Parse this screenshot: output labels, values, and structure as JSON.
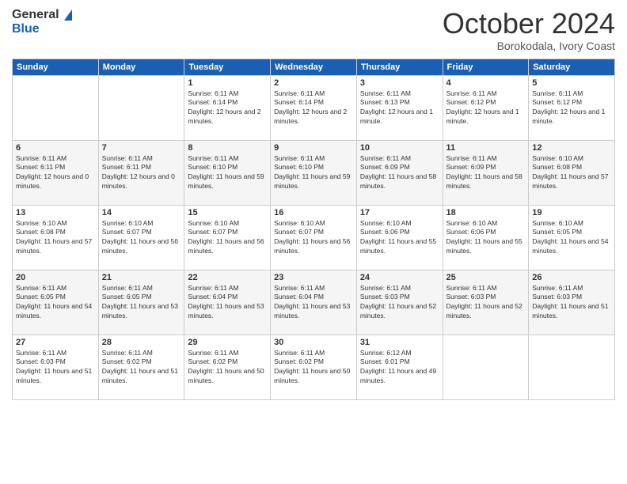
{
  "logo": {
    "general": "General",
    "blue": "Blue"
  },
  "header": {
    "month": "October 2024",
    "location": "Borokodala, Ivory Coast"
  },
  "columns": [
    "Sunday",
    "Monday",
    "Tuesday",
    "Wednesday",
    "Thursday",
    "Friday",
    "Saturday"
  ],
  "weeks": [
    [
      {
        "day": "",
        "sunrise": "",
        "sunset": "",
        "daylight": ""
      },
      {
        "day": "",
        "sunrise": "",
        "sunset": "",
        "daylight": ""
      },
      {
        "day": "1",
        "sunrise": "Sunrise: 6:11 AM",
        "sunset": "Sunset: 6:14 PM",
        "daylight": "Daylight: 12 hours and 2 minutes."
      },
      {
        "day": "2",
        "sunrise": "Sunrise: 6:11 AM",
        "sunset": "Sunset: 6:14 PM",
        "daylight": "Daylight: 12 hours and 2 minutes."
      },
      {
        "day": "3",
        "sunrise": "Sunrise: 6:11 AM",
        "sunset": "Sunset: 6:13 PM",
        "daylight": "Daylight: 12 hours and 1 minute."
      },
      {
        "day": "4",
        "sunrise": "Sunrise: 6:11 AM",
        "sunset": "Sunset: 6:12 PM",
        "daylight": "Daylight: 12 hours and 1 minute."
      },
      {
        "day": "5",
        "sunrise": "Sunrise: 6:11 AM",
        "sunset": "Sunset: 6:12 PM",
        "daylight": "Daylight: 12 hours and 1 minute."
      }
    ],
    [
      {
        "day": "6",
        "sunrise": "Sunrise: 6:11 AM",
        "sunset": "Sunset: 6:11 PM",
        "daylight": "Daylight: 12 hours and 0 minutes."
      },
      {
        "day": "7",
        "sunrise": "Sunrise: 6:11 AM",
        "sunset": "Sunset: 6:11 PM",
        "daylight": "Daylight: 12 hours and 0 minutes."
      },
      {
        "day": "8",
        "sunrise": "Sunrise: 6:11 AM",
        "sunset": "Sunset: 6:10 PM",
        "daylight": "Daylight: 11 hours and 59 minutes."
      },
      {
        "day": "9",
        "sunrise": "Sunrise: 6:11 AM",
        "sunset": "Sunset: 6:10 PM",
        "daylight": "Daylight: 11 hours and 59 minutes."
      },
      {
        "day": "10",
        "sunrise": "Sunrise: 6:11 AM",
        "sunset": "Sunset: 6:09 PM",
        "daylight": "Daylight: 11 hours and 58 minutes."
      },
      {
        "day": "11",
        "sunrise": "Sunrise: 6:11 AM",
        "sunset": "Sunset: 6:09 PM",
        "daylight": "Daylight: 11 hours and 58 minutes."
      },
      {
        "day": "12",
        "sunrise": "Sunrise: 6:10 AM",
        "sunset": "Sunset: 6:08 PM",
        "daylight": "Daylight: 11 hours and 57 minutes."
      }
    ],
    [
      {
        "day": "13",
        "sunrise": "Sunrise: 6:10 AM",
        "sunset": "Sunset: 6:08 PM",
        "daylight": "Daylight: 11 hours and 57 minutes."
      },
      {
        "day": "14",
        "sunrise": "Sunrise: 6:10 AM",
        "sunset": "Sunset: 6:07 PM",
        "daylight": "Daylight: 11 hours and 56 minutes."
      },
      {
        "day": "15",
        "sunrise": "Sunrise: 6:10 AM",
        "sunset": "Sunset: 6:07 PM",
        "daylight": "Daylight: 11 hours and 56 minutes."
      },
      {
        "day": "16",
        "sunrise": "Sunrise: 6:10 AM",
        "sunset": "Sunset: 6:07 PM",
        "daylight": "Daylight: 11 hours and 56 minutes."
      },
      {
        "day": "17",
        "sunrise": "Sunrise: 6:10 AM",
        "sunset": "Sunset: 6:06 PM",
        "daylight": "Daylight: 11 hours and 55 minutes."
      },
      {
        "day": "18",
        "sunrise": "Sunrise: 6:10 AM",
        "sunset": "Sunset: 6:06 PM",
        "daylight": "Daylight: 11 hours and 55 minutes."
      },
      {
        "day": "19",
        "sunrise": "Sunrise: 6:10 AM",
        "sunset": "Sunset: 6:05 PM",
        "daylight": "Daylight: 11 hours and 54 minutes."
      }
    ],
    [
      {
        "day": "20",
        "sunrise": "Sunrise: 6:11 AM",
        "sunset": "Sunset: 6:05 PM",
        "daylight": "Daylight: 11 hours and 54 minutes."
      },
      {
        "day": "21",
        "sunrise": "Sunrise: 6:11 AM",
        "sunset": "Sunset: 6:05 PM",
        "daylight": "Daylight: 11 hours and 53 minutes."
      },
      {
        "day": "22",
        "sunrise": "Sunrise: 6:11 AM",
        "sunset": "Sunset: 6:04 PM",
        "daylight": "Daylight: 11 hours and 53 minutes."
      },
      {
        "day": "23",
        "sunrise": "Sunrise: 6:11 AM",
        "sunset": "Sunset: 6:04 PM",
        "daylight": "Daylight: 11 hours and 53 minutes."
      },
      {
        "day": "24",
        "sunrise": "Sunrise: 6:11 AM",
        "sunset": "Sunset: 6:03 PM",
        "daylight": "Daylight: 11 hours and 52 minutes."
      },
      {
        "day": "25",
        "sunrise": "Sunrise: 6:11 AM",
        "sunset": "Sunset: 6:03 PM",
        "daylight": "Daylight: 11 hours and 52 minutes."
      },
      {
        "day": "26",
        "sunrise": "Sunrise: 6:11 AM",
        "sunset": "Sunset: 6:03 PM",
        "daylight": "Daylight: 11 hours and 51 minutes."
      }
    ],
    [
      {
        "day": "27",
        "sunrise": "Sunrise: 6:11 AM",
        "sunset": "Sunset: 6:03 PM",
        "daylight": "Daylight: 11 hours and 51 minutes."
      },
      {
        "day": "28",
        "sunrise": "Sunrise: 6:11 AM",
        "sunset": "Sunset: 6:02 PM",
        "daylight": "Daylight: 11 hours and 51 minutes."
      },
      {
        "day": "29",
        "sunrise": "Sunrise: 6:11 AM",
        "sunset": "Sunset: 6:02 PM",
        "daylight": "Daylight: 11 hours and 50 minutes."
      },
      {
        "day": "30",
        "sunrise": "Sunrise: 6:11 AM",
        "sunset": "Sunset: 6:02 PM",
        "daylight": "Daylight: 11 hours and 50 minutes."
      },
      {
        "day": "31",
        "sunrise": "Sunrise: 6:12 AM",
        "sunset": "Sunset: 6:01 PM",
        "daylight": "Daylight: 11 hours and 49 minutes."
      },
      {
        "day": "",
        "sunrise": "",
        "sunset": "",
        "daylight": ""
      },
      {
        "day": "",
        "sunrise": "",
        "sunset": "",
        "daylight": ""
      }
    ]
  ]
}
